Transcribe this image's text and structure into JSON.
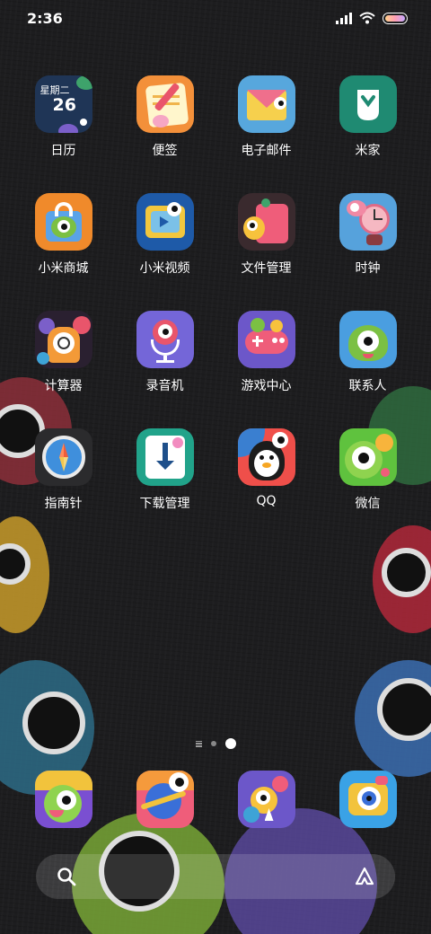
{
  "status_bar": {
    "time": "2:36"
  },
  "apps": [
    {
      "id": "calendar",
      "label": "日历",
      "icon_weekday": "星期二",
      "icon_day": "26"
    },
    {
      "id": "notes",
      "label": "便签"
    },
    {
      "id": "email",
      "label": "电子邮件"
    },
    {
      "id": "mijia",
      "label": "米家"
    },
    {
      "id": "mi-store",
      "label": "小米商城"
    },
    {
      "id": "mi-video",
      "label": "小米视频"
    },
    {
      "id": "file-manager",
      "label": "文件管理"
    },
    {
      "id": "clock",
      "label": "时钟"
    },
    {
      "id": "calculator",
      "label": "计算器"
    },
    {
      "id": "recorder",
      "label": "录音机"
    },
    {
      "id": "game-center",
      "label": "游戏中心"
    },
    {
      "id": "contacts",
      "label": "联系人"
    },
    {
      "id": "compass",
      "label": "指南针"
    },
    {
      "id": "downloads",
      "label": "下载管理"
    },
    {
      "id": "qq",
      "label": "QQ"
    },
    {
      "id": "wechat",
      "label": "微信"
    }
  ],
  "dock": [
    {
      "id": "dock-app-1",
      "icon": "green-monster-icon"
    },
    {
      "id": "dock-app-2",
      "icon": "planet-icon"
    },
    {
      "id": "dock-app-3",
      "icon": "monster-duo-icon"
    },
    {
      "id": "dock-app-4",
      "icon": "camera-icon"
    }
  ],
  "page_indicator": {
    "pages": 2,
    "current": 2
  },
  "colors": {
    "accent": "#ffffff",
    "background": "#1d1d1f"
  }
}
